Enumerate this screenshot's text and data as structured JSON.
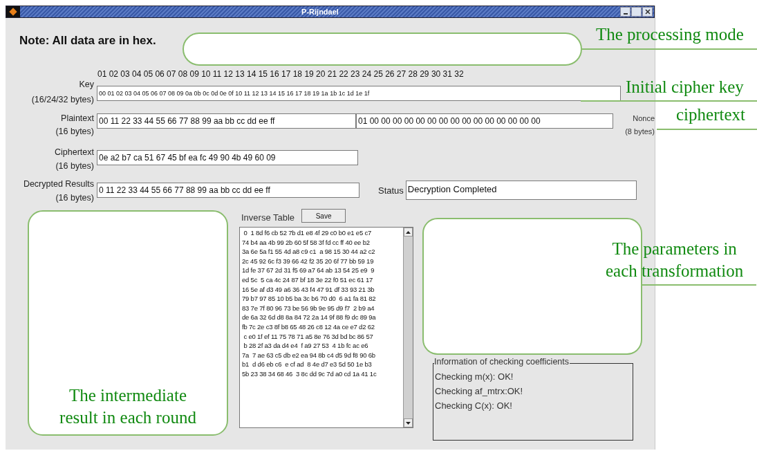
{
  "window": {
    "title": "P-Rijndael"
  },
  "note": "Note: All data are in hex.",
  "key": {
    "label": "Key",
    "sublabel": "(16/24/32 bytes)",
    "index_header": "01 02 03 04 05 06 07 08 09 10 11 12 13 14 15 16 17 18 19 20 21 22 23 24 25 26 27 28 29 30 31 32",
    "value": "00 01 02 03 04 05 06 07 08 09 0a 0b 0c 0d 0e 0f 10 11 12 13 14 15 16 17 18 19 1a 1b 1c 1d 1e 1f"
  },
  "plaintext": {
    "label": "Plaintext",
    "sublabel": "(16 bytes)",
    "value": "00 11 22 33 44 55 66 77 88 99 aa bb cc dd ee ff"
  },
  "nonce": {
    "label": "Nonce",
    "sublabel": "(8 bytes)",
    "value": "01 00 00 00 00 00 00 00 00 00 00 00 00 00 00 00"
  },
  "ciphertext": {
    "label": "Ciphertext",
    "sublabel": "(16 bytes)",
    "value": "0e a2 b7 ca 51 67 45 bf ea fc 49 90 4b 49 60 09"
  },
  "decrypted": {
    "label": "Decrypted Results",
    "sublabel": "(16 bytes)",
    "value": "0 11 22 33 44 55 66 77 88 99 aa bb cc dd ee ff"
  },
  "status": {
    "label": "Status",
    "value": "Decryption Completed"
  },
  "inverse_table": {
    "label": "Inverse Table",
    "save_button": "Save",
    "lines": [
      " 0  1 8d f6 cb 52 7b d1 e8 4f 29 c0 b0 e1 e5 c7",
      "74 b4 aa 4b 99 2b 60 5f 58 3f fd cc ff 40 ee b2",
      "3a 6e 5a f1 55 4d a8 c9 c1  a 98 15 30 44 a2 c2",
      "2c 45 92 6c f3 39 66 42 f2 35 20 6f 77 bb 59 19",
      "1d fe 37 67 2d 31 f5 69 a7 64 ab 13 54 25 e9  9",
      "ed 5c  5 ca 4c 24 87 bf 18 3e 22 f0 51 ec 61 17",
      "16 5e af d3 49 a6 36 43 f4 47 91 df 33 93 21 3b",
      "79 b7 97 85 10 b5 ba 3c b6 70 d0  6 a1 fa 81 82",
      "83 7e 7f 80 96 73 be 56 9b 9e 95 d9 f7  2 b9 a4",
      "de 6a 32 6d d8 8a 84 72 2a 14 9f 88 f9 dc 89 9a",
      "fb 7c 2e c3 8f b8 65 48 26 c8 12 4a ce e7 d2 62",
      " c e0 1f ef 11 75 78 71 a5 8e 76 3d bd bc 86 57",
      " b 28 2f a3 da d4 e4  f a9 27 53  4 1b fc ac e6",
      "7a  7 ae 63 c5 db e2 ea 94 8b c4 d5 9d f8 90 6b",
      "b1  d d6 eb c6  e cf ad  8 4e d7 e3 5d 50 1e b3",
      "5b 23 38 34 68 46  3 8c dd 9c 7d a0 cd 1a 41 1c"
    ]
  },
  "checking": {
    "title": "Information of checking coefficients",
    "lines": [
      "Checking m(x): OK!",
      "Checking af_mtrx:OK!",
      "Checking C(x): OK!"
    ]
  },
  "annotations": {
    "processing_mode": "The processing mode",
    "initial_key": "Initial cipher key",
    "ciphertext": "ciphertext",
    "parameters": [
      "The parameters in",
      "each transformation"
    ],
    "intermediate": [
      "The intermediate",
      "result in each round"
    ]
  }
}
